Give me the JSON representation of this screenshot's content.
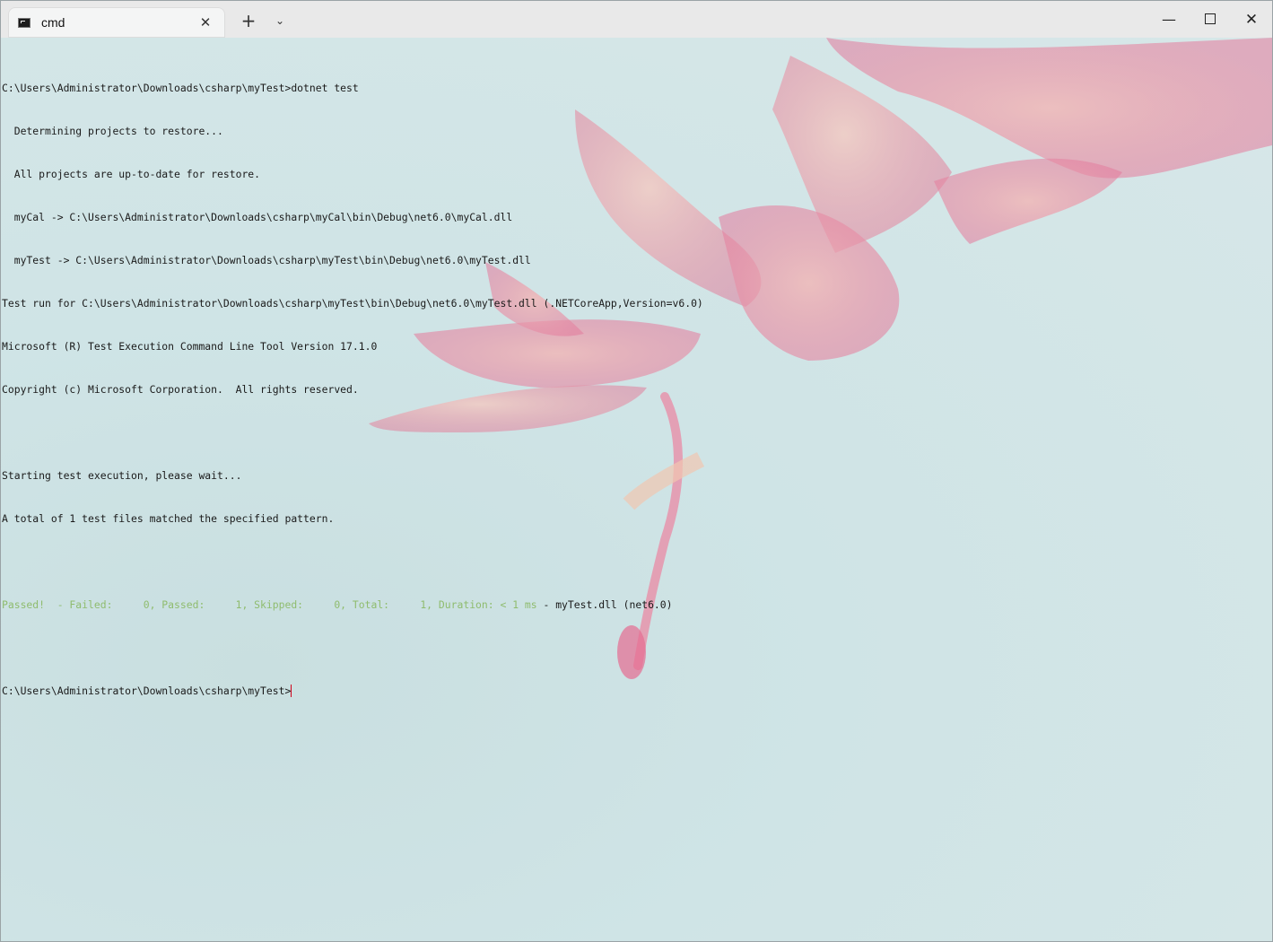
{
  "tab": {
    "title": "cmd"
  },
  "window_controls": {
    "new_tab": "+",
    "dropdown": "⌄",
    "minimize": "—",
    "close": "✕"
  },
  "terminal": {
    "lines": [
      "C:\\Users\\Administrator\\Downloads\\csharp\\myTest>dotnet test",
      "  Determining projects to restore...",
      "  All projects are up-to-date for restore.",
      "  myCal -> C:\\Users\\Administrator\\Downloads\\csharp\\myCal\\bin\\Debug\\net6.0\\myCal.dll",
      "  myTest -> C:\\Users\\Administrator\\Downloads\\csharp\\myTest\\bin\\Debug\\net6.0\\myTest.dll",
      "Test run for C:\\Users\\Administrator\\Downloads\\csharp\\myTest\\bin\\Debug\\net6.0\\myTest.dll (.NETCoreApp,Version=v6.0)",
      "Microsoft (R) Test Execution Command Line Tool Version 17.1.0",
      "Copyright (c) Microsoft Corporation.  All rights reserved.",
      "",
      "Starting test execution, please wait...",
      "A total of 1 test files matched the specified pattern.",
      ""
    ],
    "result_line": {
      "passed_part": "Passed!  - Failed:     0, Passed:     1, Skipped:     0, Total:     1, Duration: < 1 ms",
      "rest_part": " - myTest.dll (net6.0)"
    },
    "blank_after": "",
    "prompt": "C:\\Users\\Administrator\\Downloads\\csharp\\myTest>"
  },
  "colors": {
    "passed_green": "#8fbc6e",
    "cursor": "#d0021b",
    "background_pink": "#e8a0b4"
  }
}
